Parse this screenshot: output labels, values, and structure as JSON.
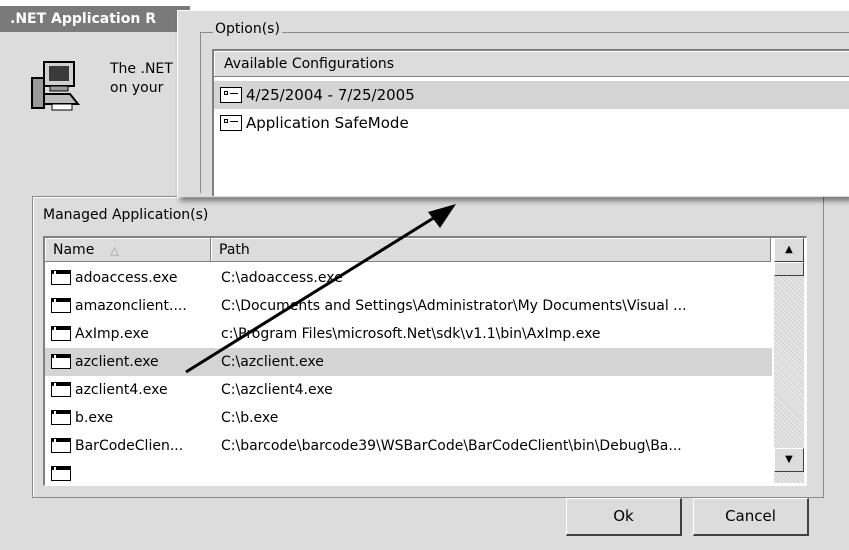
{
  "dialog": {
    "title": ".NET Application R",
    "intro_text": "The .NET\non your"
  },
  "managed": {
    "legend": "Managed Application(s)",
    "columns": {
      "name": "Name",
      "path": "Path"
    },
    "rows": [
      {
        "name": "adoaccess.exe",
        "path": "C:\\adoaccess.exe"
      },
      {
        "name": "amazonclient....",
        "path": "C:\\Documents and Settings\\Administrator\\My Documents\\Visual ..."
      },
      {
        "name": "AxImp.exe",
        "path": "c:\\Program Files\\microsoft.Net\\sdk\\v1.1\\bin\\AxImp.exe"
      },
      {
        "name": "azclient.exe",
        "path": "C:\\azclient.exe",
        "selected": true
      },
      {
        "name": "azclient4.exe",
        "path": "C:\\azclient4.exe"
      },
      {
        "name": "b.exe",
        "path": "C:\\b.exe"
      },
      {
        "name": "BarCodeClien...",
        "path": "C:\\barcode\\barcode39\\WSBarCode\\BarCodeClient\\bin\\Debug\\Ba..."
      }
    ]
  },
  "buttons": {
    "ok": "Ok",
    "cancel": "Cancel"
  },
  "options": {
    "legend": "Option(s)",
    "header": "Available Configurations",
    "items": [
      "4/25/2004 - 7/25/2005",
      "Application SafeMode"
    ]
  },
  "scroll": {
    "up_glyph": "▲",
    "down_glyph": "▼",
    "sort_glyph": "△"
  },
  "colors": {
    "title_bar": "#7a7a7a",
    "window": "#dcdcdc",
    "selection": "#d4d4d4"
  }
}
